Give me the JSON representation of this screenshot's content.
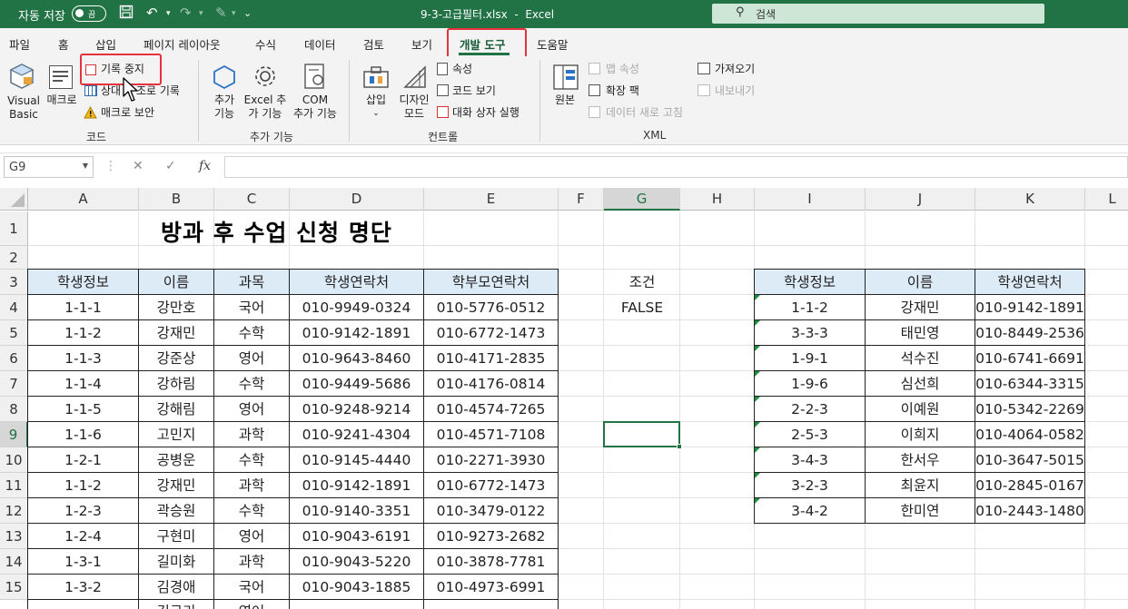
{
  "titlebar": {
    "autosave": "자동 저장",
    "toggle": "끔",
    "filename": "9-3-고급필터.xlsx",
    "sep": "-",
    "app": "Excel",
    "search_placeholder": "검색"
  },
  "tabs": [
    "파일",
    "홈",
    "삽입",
    "페이지 레이아웃",
    "수식",
    "데이터",
    "검토",
    "보기",
    "개발 도구",
    "도움말"
  ],
  "active_tab": "개발 도구",
  "ribbon": {
    "code": {
      "visual_basic": [
        "Visual",
        "Basic"
      ],
      "macro": "매크로",
      "record_stop": "기록 중지",
      "relative": "상대",
      "relative_rest": "조로 기록",
      "macro_security": "매크로 보안",
      "group": "코드"
    },
    "addins": {
      "addins": [
        "추가",
        "기능"
      ],
      "excel_addins": [
        "Excel 추",
        "가 기능"
      ],
      "com_addins": [
        "COM",
        "추가 기능"
      ],
      "group": "추가 기능"
    },
    "controls": {
      "insert": "삽입",
      "design": [
        "디자인",
        "모드"
      ],
      "properties": "속성",
      "view_code": "코드 보기",
      "dialog": "대화 상자 실행",
      "group": "컨트롤"
    },
    "xml": {
      "source": "원본",
      "map_props": "맵 속성",
      "expansion": "확장 팩",
      "refresh": "데이터 새로 고침",
      "import": "가져오기",
      "export": "내보내기",
      "group": "XML"
    }
  },
  "formula_bar": {
    "name_box": "G9",
    "cancel": "✕",
    "enter": "✓",
    "fx": "fx",
    "value": ""
  },
  "columns": [
    "A",
    "B",
    "C",
    "D",
    "E",
    "F",
    "G",
    "H",
    "I",
    "J",
    "K",
    "L"
  ],
  "rows": [
    "1",
    "2",
    "3",
    "4",
    "5",
    "6",
    "7",
    "8",
    "9",
    "10",
    "11",
    "12",
    "13",
    "14",
    "15"
  ],
  "selected_cell": "G9",
  "sheet_title": "방과 후 수업 신청 명단",
  "main_table": {
    "headers": [
      "학생정보",
      "이름",
      "과목",
      "학생연락처",
      "학부모연락처"
    ],
    "rows": [
      [
        "1-1-1",
        "강만호",
        "국어",
        "010-9949-0324",
        "010-5776-0512"
      ],
      [
        "1-1-2",
        "강재민",
        "수학",
        "010-9142-1891",
        "010-6772-1473"
      ],
      [
        "1-1-3",
        "강준상",
        "영어",
        "010-9643-8460",
        "010-4171-2835"
      ],
      [
        "1-1-4",
        "강하림",
        "수학",
        "010-9449-5686",
        "010-4176-0814"
      ],
      [
        "1-1-5",
        "강해림",
        "영어",
        "010-9248-9214",
        "010-4574-7265"
      ],
      [
        "1-1-6",
        "고민지",
        "과학",
        "010-9241-4304",
        "010-4571-7108"
      ],
      [
        "1-2-1",
        "공병운",
        "수학",
        "010-9145-4440",
        "010-2271-3930"
      ],
      [
        "1-1-2",
        "강재민",
        "과학",
        "010-9142-1891",
        "010-6772-1473"
      ],
      [
        "1-2-3",
        "곽승원",
        "수학",
        "010-9140-3351",
        "010-3479-0122"
      ],
      [
        "1-2-4",
        "구현미",
        "영어",
        "010-9043-6191",
        "010-9273-2682"
      ],
      [
        "1-3-1",
        "길미화",
        "과학",
        "010-9043-5220",
        "010-3878-7781"
      ],
      [
        "1-3-2",
        "김경애",
        "국어",
        "010-9043-1885",
        "010-4973-6991"
      ]
    ],
    "partial_row": [
      "",
      "김규리",
      "영어",
      "",
      ""
    ]
  },
  "criteria": {
    "label": "조건",
    "value": "FALSE"
  },
  "result_table": {
    "headers": [
      "학생정보",
      "이름",
      "학생연락처"
    ],
    "rows": [
      [
        "1-1-2",
        "강재민",
        "010-9142-1891"
      ],
      [
        "3-3-3",
        "태민영",
        "010-8449-2536"
      ],
      [
        "1-9-1",
        "석수진",
        "010-6741-6691"
      ],
      [
        "1-9-6",
        "심선희",
        "010-6344-3315"
      ],
      [
        "2-2-3",
        "이예원",
        "010-5342-2269"
      ],
      [
        "2-5-3",
        "이희지",
        "010-4064-0582"
      ],
      [
        "3-4-3",
        "한서우",
        "010-3647-5015"
      ],
      [
        "3-2-3",
        "최윤지",
        "010-2845-0167"
      ],
      [
        "3-4-2",
        "한미연",
        "010-2443-1480"
      ]
    ]
  },
  "colors": {
    "excel_green": "#217346",
    "header_fill": "#ddebf7",
    "highlight": "#e8323b",
    "error_triangle": "#1e8f3e"
  }
}
